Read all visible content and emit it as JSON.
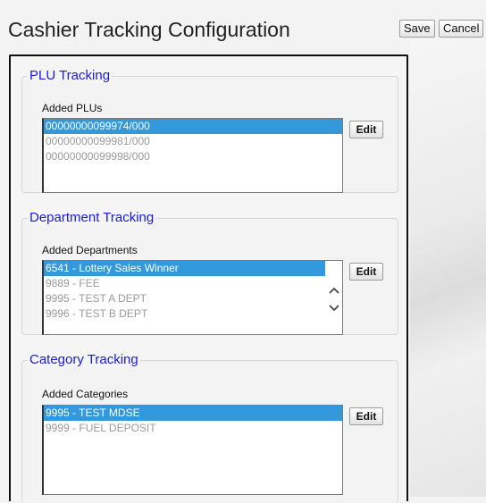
{
  "header": {
    "title": "Cashier Tracking Configuration",
    "save_label": "Save",
    "cancel_label": "Cancel"
  },
  "plu": {
    "legend": "PLU Tracking",
    "list_label": "Added PLUs",
    "edit_label": "Edit",
    "items": [
      "00000000099974/000",
      "00000000099981/000",
      "00000000099998/000"
    ],
    "selected_index": 0
  },
  "department": {
    "legend": "Department Tracking",
    "list_label": "Added Departments",
    "edit_label": "Edit",
    "items": [
      "6541 - Lottery Sales Winner",
      "9889 - FEE",
      "9995 - TEST A DEPT",
      "9996 - TEST B DEPT"
    ],
    "selected_index": 0
  },
  "category": {
    "legend": "Category Tracking",
    "list_label": "Added Categories",
    "edit_label": "Edit",
    "items": [
      "9995 - TEST MDSE",
      "9999 - FUEL DEPOSIT"
    ],
    "selected_index": 0
  },
  "colors": {
    "selection": "#3399dd",
    "legend": "#1a1adb"
  }
}
